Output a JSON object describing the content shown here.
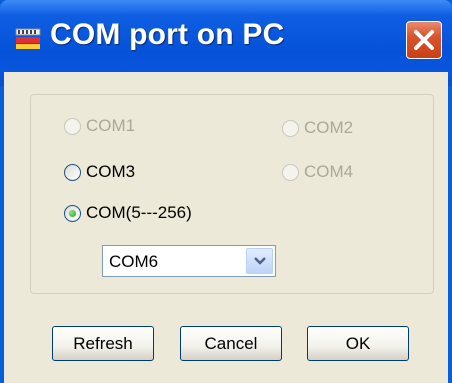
{
  "window": {
    "title": "COM port on PC"
  },
  "radios": [
    {
      "label": "COM1",
      "enabled": false,
      "selected": false
    },
    {
      "label": "COM2",
      "enabled": false,
      "selected": false
    },
    {
      "label": "COM3",
      "enabled": true,
      "selected": false
    },
    {
      "label": "COM4",
      "enabled": false,
      "selected": false
    },
    {
      "label": "COM(5---256)",
      "enabled": true,
      "selected": true
    }
  ],
  "com_select": {
    "value": "COM6"
  },
  "buttons": {
    "refresh": "Refresh",
    "cancel": "Cancel",
    "ok": "OK"
  },
  "colors": {
    "titlebar": "#0552d8",
    "close": "#d8552d",
    "face": "#ece9d8"
  }
}
